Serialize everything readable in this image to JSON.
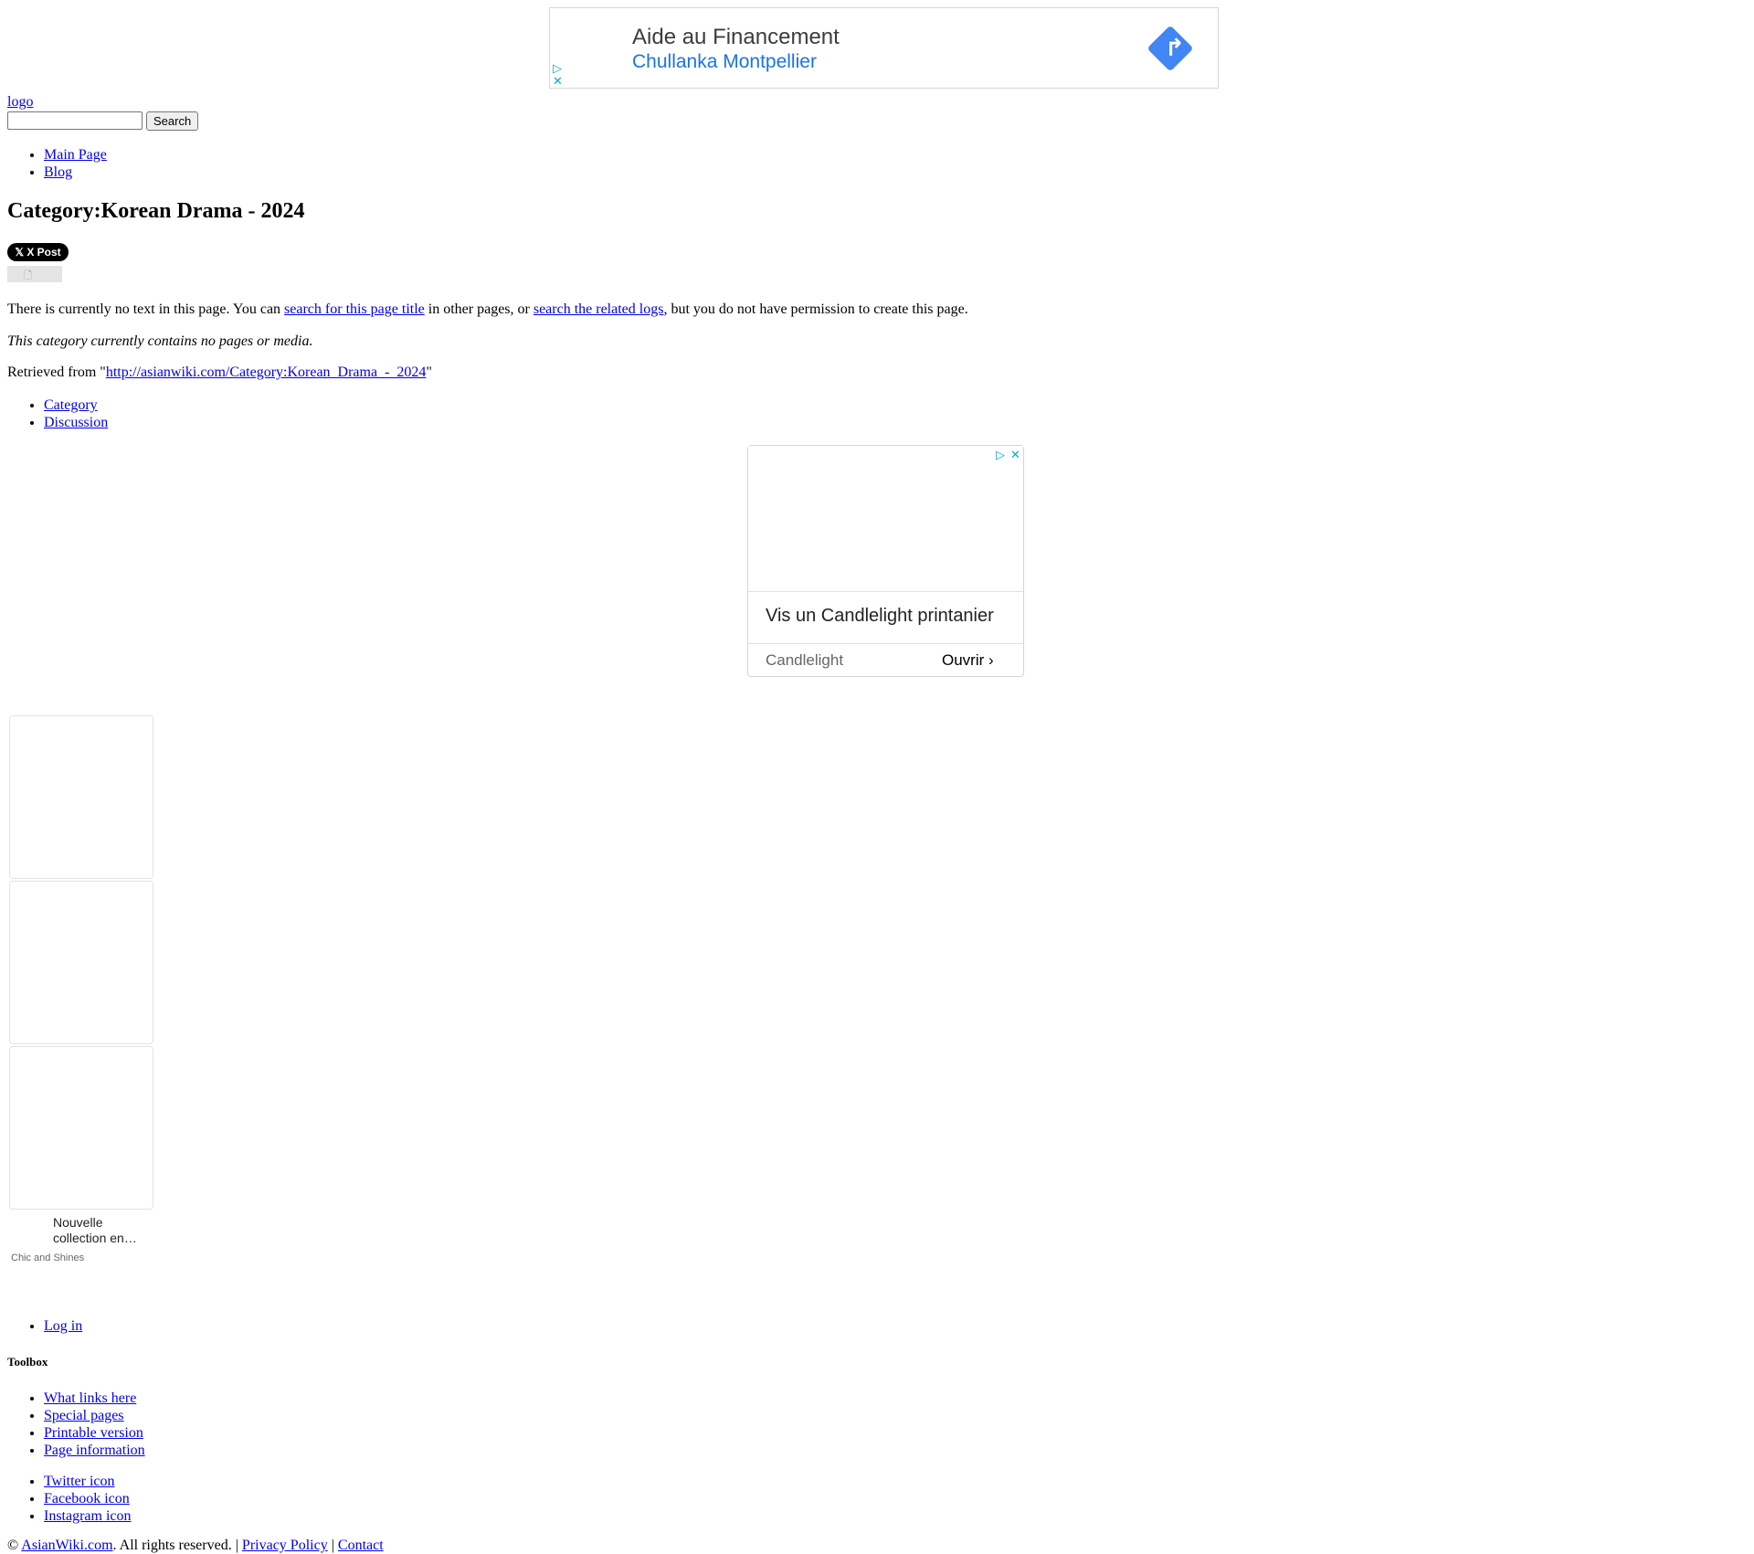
{
  "top_ad": {
    "headline": "Aide au Financement",
    "advertiser": "Chullanka Montpellier",
    "icon": "directions-arrow-icon",
    "brand_color": "#4285f4"
  },
  "header": {
    "logo_alt": "logo",
    "search_button": "Search"
  },
  "nav": [
    "Main Page",
    "Blog"
  ],
  "page": {
    "title": "Category:Korean Drama - 2024",
    "share_button": "X Post",
    "notice_pre": "There is currently no text in this page. You can ",
    "notice_link1": "search for this page title",
    "notice_mid": " in other pages, or ",
    "notice_link2": "search the related logs",
    "notice_post": ", but you do not have permission to create this page.",
    "empty_note": "This category currently contains no pages or media.",
    "retrieved_pre": "Retrieved from \"",
    "retrieved_url": "http://asianwiki.com/Category:Korean_Drama_-_2024",
    "retrieved_post": "\""
  },
  "namespace_tabs": [
    "Category",
    "Discussion"
  ],
  "mid_ad": {
    "headline": "Vis un Candlelight printanier",
    "advertiser": "Candlelight",
    "cta": "Ouvrir"
  },
  "side_ad": {
    "caption_line1": "Nouvelle",
    "caption_line2": "collection en…",
    "brand": "Chic and Shines"
  },
  "personal_tools": [
    "Log in"
  ],
  "toolbox": {
    "heading": "Toolbox",
    "items": [
      "What links here",
      "Special pages",
      "Printable version",
      "Page information"
    ]
  },
  "social": [
    "Twitter icon",
    "Facebook icon",
    "Instagram icon"
  ],
  "footer": {
    "copyright": "© ",
    "site_link": "AsianWiki.com",
    "rights": ". All rights reserved. | ",
    "privacy": "Privacy Policy",
    "sep": " | ",
    "contact": "Contact"
  },
  "colors": {
    "link": "#0000ee",
    "adchoices": "#00aecd",
    "ad_link": "#1a73e8"
  }
}
